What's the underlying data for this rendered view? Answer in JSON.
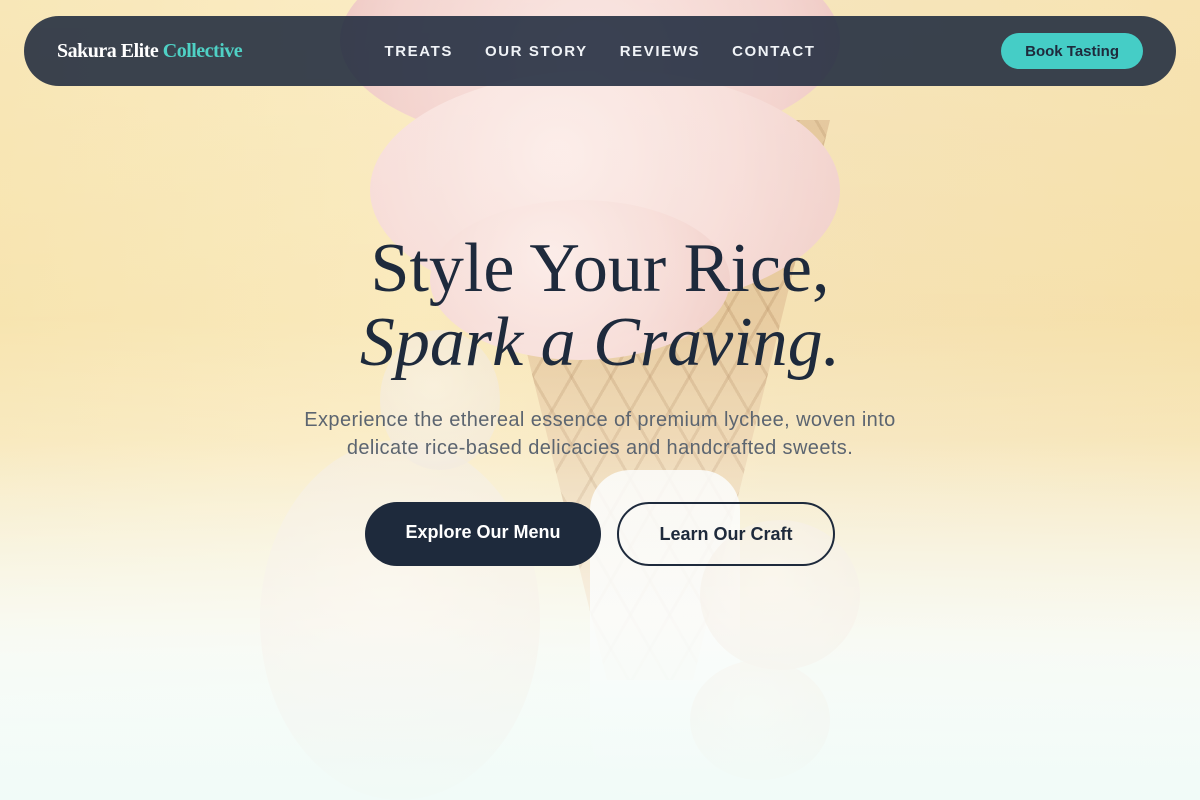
{
  "brand": {
    "name_main": "Sakura Elite",
    "name_accent": "Collective"
  },
  "nav": {
    "links": [
      "TREATS",
      "OUR STORY",
      "REVIEWS",
      "CONTACT"
    ],
    "cta_label": "Book Tasting"
  },
  "hero": {
    "headline_line1": "Style Your Rice,",
    "headline_line2": "Spark a Craving.",
    "subtitle": "Experience the ethereal essence of premium lychee, woven into delicate rice-based delicacies and handcrafted sweets.",
    "primary_cta": "Explore Our Menu",
    "secondary_cta": "Learn Our Craft"
  },
  "colors": {
    "nav_bg": "#1f2a3d",
    "accent": "#4fd1c5",
    "button_dark": "#1e2a3c",
    "hero_bg": "#f6e3a8"
  }
}
